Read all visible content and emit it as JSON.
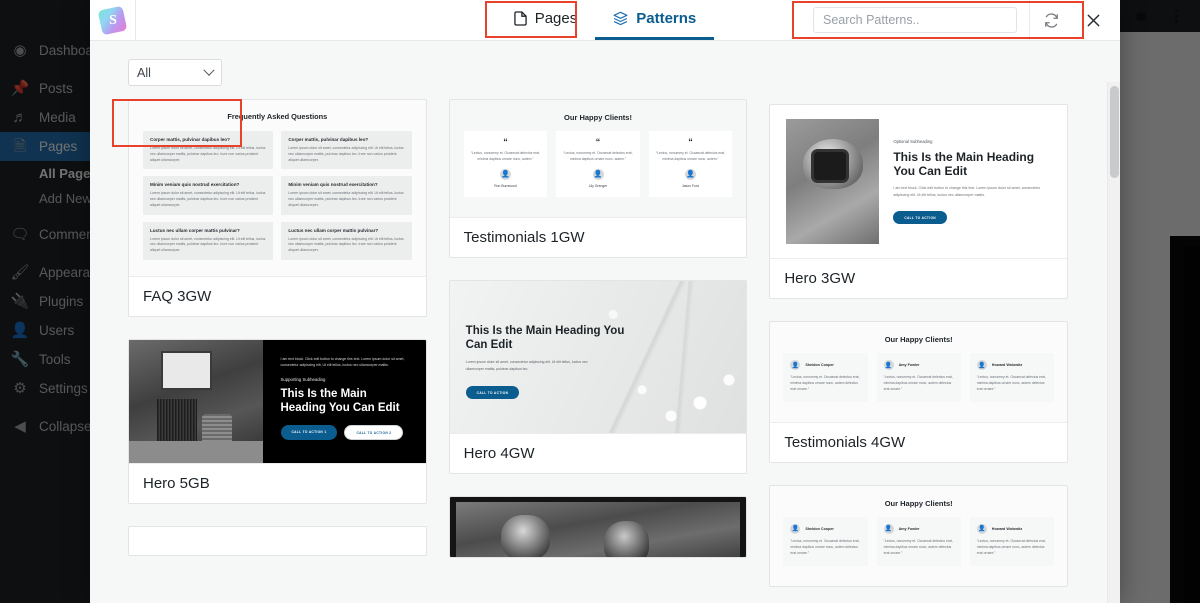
{
  "wp_admin": {
    "adminbar": {
      "gear_icon": "gear-icon",
      "kebab_icon": "kebab-menu-icon"
    },
    "menu": [
      {
        "label": "Dashboard",
        "icon": "dashboard-icon",
        "current": false
      },
      {
        "label": "Posts",
        "icon": "pin-icon",
        "current": false
      },
      {
        "label": "Media",
        "icon": "media-icon",
        "current": false
      },
      {
        "label": "Pages",
        "icon": "pages-icon",
        "current": true
      },
      {
        "label": "Comments",
        "icon": "comments-icon",
        "current": false
      },
      {
        "label": "Appearance",
        "icon": "brush-icon",
        "current": false
      },
      {
        "label": "Plugins",
        "icon": "plugin-icon",
        "current": false
      },
      {
        "label": "Users",
        "icon": "user-icon",
        "current": false
      },
      {
        "label": "Tools",
        "icon": "wrench-icon",
        "current": false
      },
      {
        "label": "Settings",
        "icon": "settings-icon",
        "current": false
      },
      {
        "label": "Collapse menu",
        "icon": "collapse-icon",
        "current": false
      }
    ],
    "submenu": [
      {
        "label": "All Pages",
        "current": true
      },
      {
        "label": "Add New",
        "current": false
      }
    ]
  },
  "modal": {
    "logo_letter": "S",
    "tabs": [
      {
        "label": "Pages",
        "icon": "page-icon",
        "active": false,
        "highlighted": true
      },
      {
        "label": "Patterns",
        "icon": "layers-icon",
        "active": true,
        "highlighted": false
      }
    ],
    "search": {
      "placeholder": "Search Patterns..",
      "value": "",
      "icon": "search-input"
    },
    "sync_icon": "refresh-icon",
    "close_icon": "close-icon",
    "filter": {
      "selected": "All",
      "caret_icon": "chevron-down-icon",
      "options": [
        "All"
      ]
    },
    "annotations": {
      "pages_tab_box": "red-highlight-pages-tab",
      "search_box": "red-highlight-search",
      "filter_box": "red-highlight-filter"
    }
  },
  "patterns": {
    "col1": [
      {
        "caption": "FAQ 3GW",
        "type": "faq",
        "heading": "Frequently Asked Questions",
        "items": [
          {
            "q": "Corper mattis, pulvinar dapibus leo?",
            "a": "Lorem ipsum dolor sit amet, consectetur adipiscing elit. Ut elit tellus, luctus nec ullamcorper mattis, pulvinar dapibus leo. Irure non varius proident aliquet ullamcorper."
          },
          {
            "q": "Corper mattis, pulvinar dapibus leo?",
            "a": "Lorem ipsum dolor sit amet, consectetur adipiscing elit. Ut elit tellus, luctus nec ullamcorper mattis, pulvinar dapibus leo. Irure non varius proident aliquet ullamcorper."
          },
          {
            "q": "Minim veniam quis nostrud exercitation?",
            "a": "Lorem ipsum dolor sit amet, consectetur adipiscing elit. Ut elit tellus, luctus nec ullamcorper mattis, pulvinar dapibus leo. Irure non varius proident aliquet ullamcorper."
          },
          {
            "q": "Minim veniam quis nostrud exercitation?",
            "a": "Lorem ipsum dolor sit amet, consectetur adipiscing elit. Ut elit tellus, luctus nec ullamcorper mattis, pulvinar dapibus leo. Irure non varius proident aliquet ullamcorper."
          },
          {
            "q": "Luctus nec ullam corper mattis pulvinar?",
            "a": "Lorem ipsum dolor sit amet, consectetur adipiscing elit. Ut elit tellus, luctus nec ullamcorper mattis, pulvinar dapibus leo. Irure non varius proident aliquet ullamcorper."
          },
          {
            "q": "Luctus nec ullam corper mattis pulvinar?",
            "a": "Lorem ipsum dolor sit amet, consectetur adipiscing elit. Ut elit tellus, luctus nec ullamcorper mattis, pulvinar dapibus leo. Irure non varius proident aliquet ullamcorper."
          }
        ]
      },
      {
        "caption": "Hero 5GB",
        "type": "hero-split-dark",
        "body": "I am text block. Click edit button to change this text. Lorem ipsum dolor sit amet, consectetur adipiscing elit. Ut elit tellus, luctus nec ullamcorper mattis.",
        "subheading": "Supporting Subheading",
        "heading": "This Is the Main Heading You Can Edit",
        "cta_primary": "CALL TO ACTION 1",
        "cta_secondary": "CALL TO ACTION 2"
      },
      {
        "caption": "",
        "type": "blank"
      }
    ],
    "col2": [
      {
        "caption": "Testimonials 1GW",
        "type": "testimonials-quote",
        "heading": "Our Happy Clients!",
        "quote_glyph": "“",
        "items": [
          {
            "text": "“Lectus, nonummy et. Occaecat delectus erat, minima dapibus ornare nunc, autem.”",
            "name": "Ron Burnwood"
          },
          {
            "text": "“Lectus, nonummy et. Occaecat delectus erat, minima dapibus ornare nunc, autem.”",
            "name": "Lily Granger"
          },
          {
            "text": "“Lectus, nonummy et. Occaecat delectus erat, minima dapibus ornare nunc, autem.”",
            "name": "Jason Foxx"
          }
        ]
      },
      {
        "caption": "Hero 4GW",
        "type": "hero-bg-light",
        "heading": "This Is the Main Heading You Can Edit",
        "body": "Lorem ipsum dolor sit amet, consectetur adipiscing elit. Ut elit tellus, luctus nec ullamcorper mattis, pulvinar dapibus leo.",
        "cta_primary": "CALL TO ACTION"
      },
      {
        "caption": "",
        "type": "hero-photo-dark"
      }
    ],
    "col3": [
      {
        "caption": "Hero 3GW",
        "type": "hero-image-left",
        "subheading": "Optional Subheading",
        "heading": "This Is the Main Heading You Can Edit",
        "body": "I am text block. Click edit button to change this text. Lorem ipsum dolor sit amet, consectetur adipiscing elit. Ut elit tellus, luctus nec ullamcorper mattis.",
        "cta_primary": "CALL TO ACTION"
      },
      {
        "caption": "Testimonials 4GW",
        "type": "testimonials-inline",
        "heading": "Our Happy Clients!",
        "items": [
          {
            "name": "Sheldon Cooper",
            "text": "“Lectus, nonummy et. Occaecat delectus erat, minima dapibus ornare nunc, autem delectus erat ornare.”"
          },
          {
            "name": "Amy Fowler",
            "text": "“Lectus, nonummy et. Occaecat delectus erat, minima dapibus ornare nunc, autem delectus erat ornare.”"
          },
          {
            "name": "Howard Wolowitz",
            "text": "“Lectus, nonummy et. Occaecat delectus erat, minima dapibus ornare nunc, autem delectus erat ornare.”"
          }
        ]
      },
      {
        "caption": "",
        "type": "testimonials-inline",
        "heading": "Our Happy Clients!",
        "items": [
          {
            "name": "Sheldon Cooper",
            "text": "“Lectus, nonummy et. Occaecat delectus erat, minima dapibus ornare nunc, autem delectus erat ornare.”"
          },
          {
            "name": "Amy Fowler",
            "text": "“Lectus, nonummy et. Occaecat delectus erat, minima dapibus ornare nunc, autem delectus erat ornare.”"
          },
          {
            "name": "Howard Wolowitz",
            "text": "“Lectus, nonummy et. Occaecat delectus erat, minima dapibus ornare nunc, autem delectus erat ornare.”"
          }
        ]
      }
    ]
  },
  "colors": {
    "accent_blue": "#0b5c8f",
    "wp_blue": "#2271b1",
    "annotation_red": "#e8422c",
    "admin_dark": "#1d2327"
  }
}
